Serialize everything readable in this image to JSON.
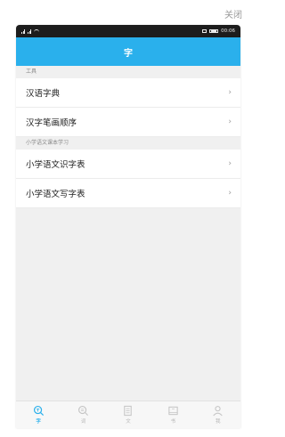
{
  "close_label": "关闭",
  "status": {
    "left": "",
    "time": "00:06"
  },
  "header": {
    "title": "字"
  },
  "sections": [
    {
      "title": "工具",
      "items": [
        {
          "label": "汉语字典"
        },
        {
          "label": "汉字笔画顺序"
        }
      ]
    },
    {
      "title": "小学语文课本学习",
      "items": [
        {
          "label": "小学语文识字表"
        },
        {
          "label": "小学语文写字表"
        }
      ]
    }
  ],
  "chevron": "›",
  "tabs": [
    {
      "label": "字",
      "icon": "search-char-icon",
      "active": true
    },
    {
      "label": "词",
      "icon": "search-word-icon",
      "active": false
    },
    {
      "label": "文",
      "icon": "document-icon",
      "active": false
    },
    {
      "label": "书",
      "icon": "book-icon",
      "active": false
    },
    {
      "label": "我",
      "icon": "user-icon",
      "active": false
    }
  ],
  "colors": {
    "accent": "#2ab0ec",
    "statusbar": "#1d1d1d",
    "background": "#f0f0f0"
  }
}
